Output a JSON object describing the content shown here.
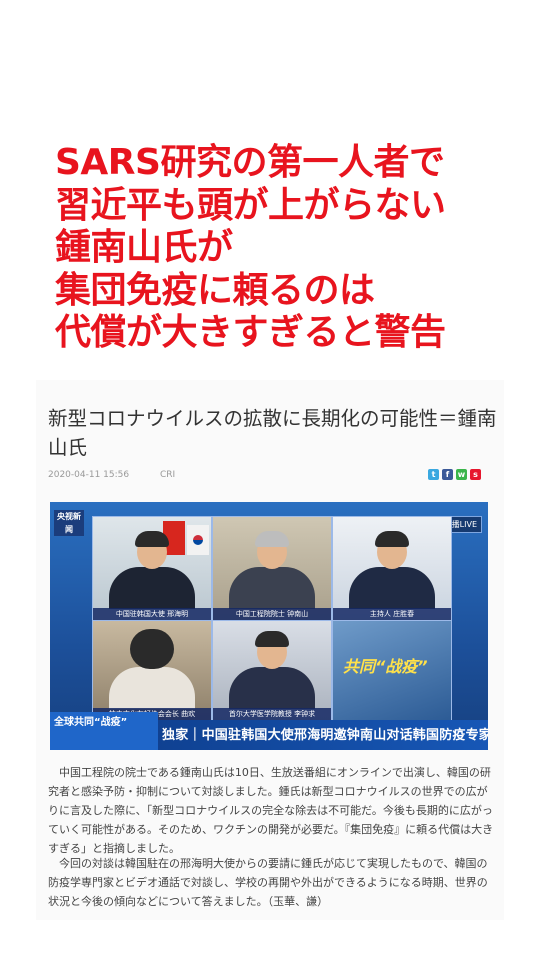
{
  "headline": {
    "lines": [
      "SARS研究の第一人者で",
      "習近平も頭が上がらない",
      "鍾南山氏が",
      "集団免疫に頼るのは",
      "代償が大きすぎると警告"
    ],
    "color": "#e8141e"
  },
  "article": {
    "title": "新型コロナウイルスの拡散に長期化の可能性＝鍾南山氏",
    "date": "2020-04-11 15:56",
    "source": "CRI",
    "share_icons": [
      "twitter-icon",
      "facebook-icon",
      "wechat-icon",
      "weibo-icon"
    ],
    "video": {
      "channel_logo": "央视新闻",
      "live_badge": "直播LIVE",
      "panels": [
        {
          "caption": "中国驻韩国大使 邢海明"
        },
        {
          "caption": "中国工程院院士 钟南山"
        },
        {
          "caption": "主持人 庄胜春"
        },
        {
          "caption": "韩中文化友好协会会长 曲欢"
        },
        {
          "caption": "首尔大学医学院教授 李钟求"
        },
        {
          "caption": "共同“战疫”"
        }
      ],
      "banner_left": "全球共同“战疫”",
      "banner_text": "独家｜中国驻韩国大使邢海明邀钟南山对话韩国防疫专家"
    },
    "paragraphs": [
      "中国工程院の院士である鍾南山氏は10日、生放送番組にオンラインで出演し、韓国の研究者と感染予防・抑制について対談しました。鍾氏は新型コロナウイルスの世界での広がりに言及した際に、「新型コロナウイルスの完全な除去は不可能だ。今後も長期的に広がっていく可能性がある。そのため、ワクチンの開発が必要だ。『集団免疫』に頼る代償は大きすぎる」と指摘しました。",
      "今回の対談は韓国駐在の邢海明大使からの要請に鍾氏が応じて実現したもので、韓国の防疫学専門家とビデオ通話で対談し、学校の再開や外出ができるようになる時期、世界の状況と今後の傾向などについて答えました。（玉華、謙）"
    ]
  }
}
